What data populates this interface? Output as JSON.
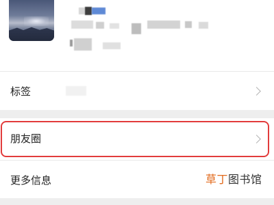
{
  "colors": {
    "accent_red": "#e23b3b",
    "watermark_orange": "#e26a1c",
    "watermark_dark": "#333333",
    "section_gap": "#eeeeee"
  },
  "menu": {
    "tags_label": "标签",
    "moments_label": "朋友圈",
    "more_info_label": "更多信息"
  },
  "watermark": {
    "part1": "草丁",
    "part2": "图书馆"
  },
  "icons": {
    "tags_arrow": "chevron-right-icon",
    "moments_arrow": "chevron-right-icon"
  }
}
